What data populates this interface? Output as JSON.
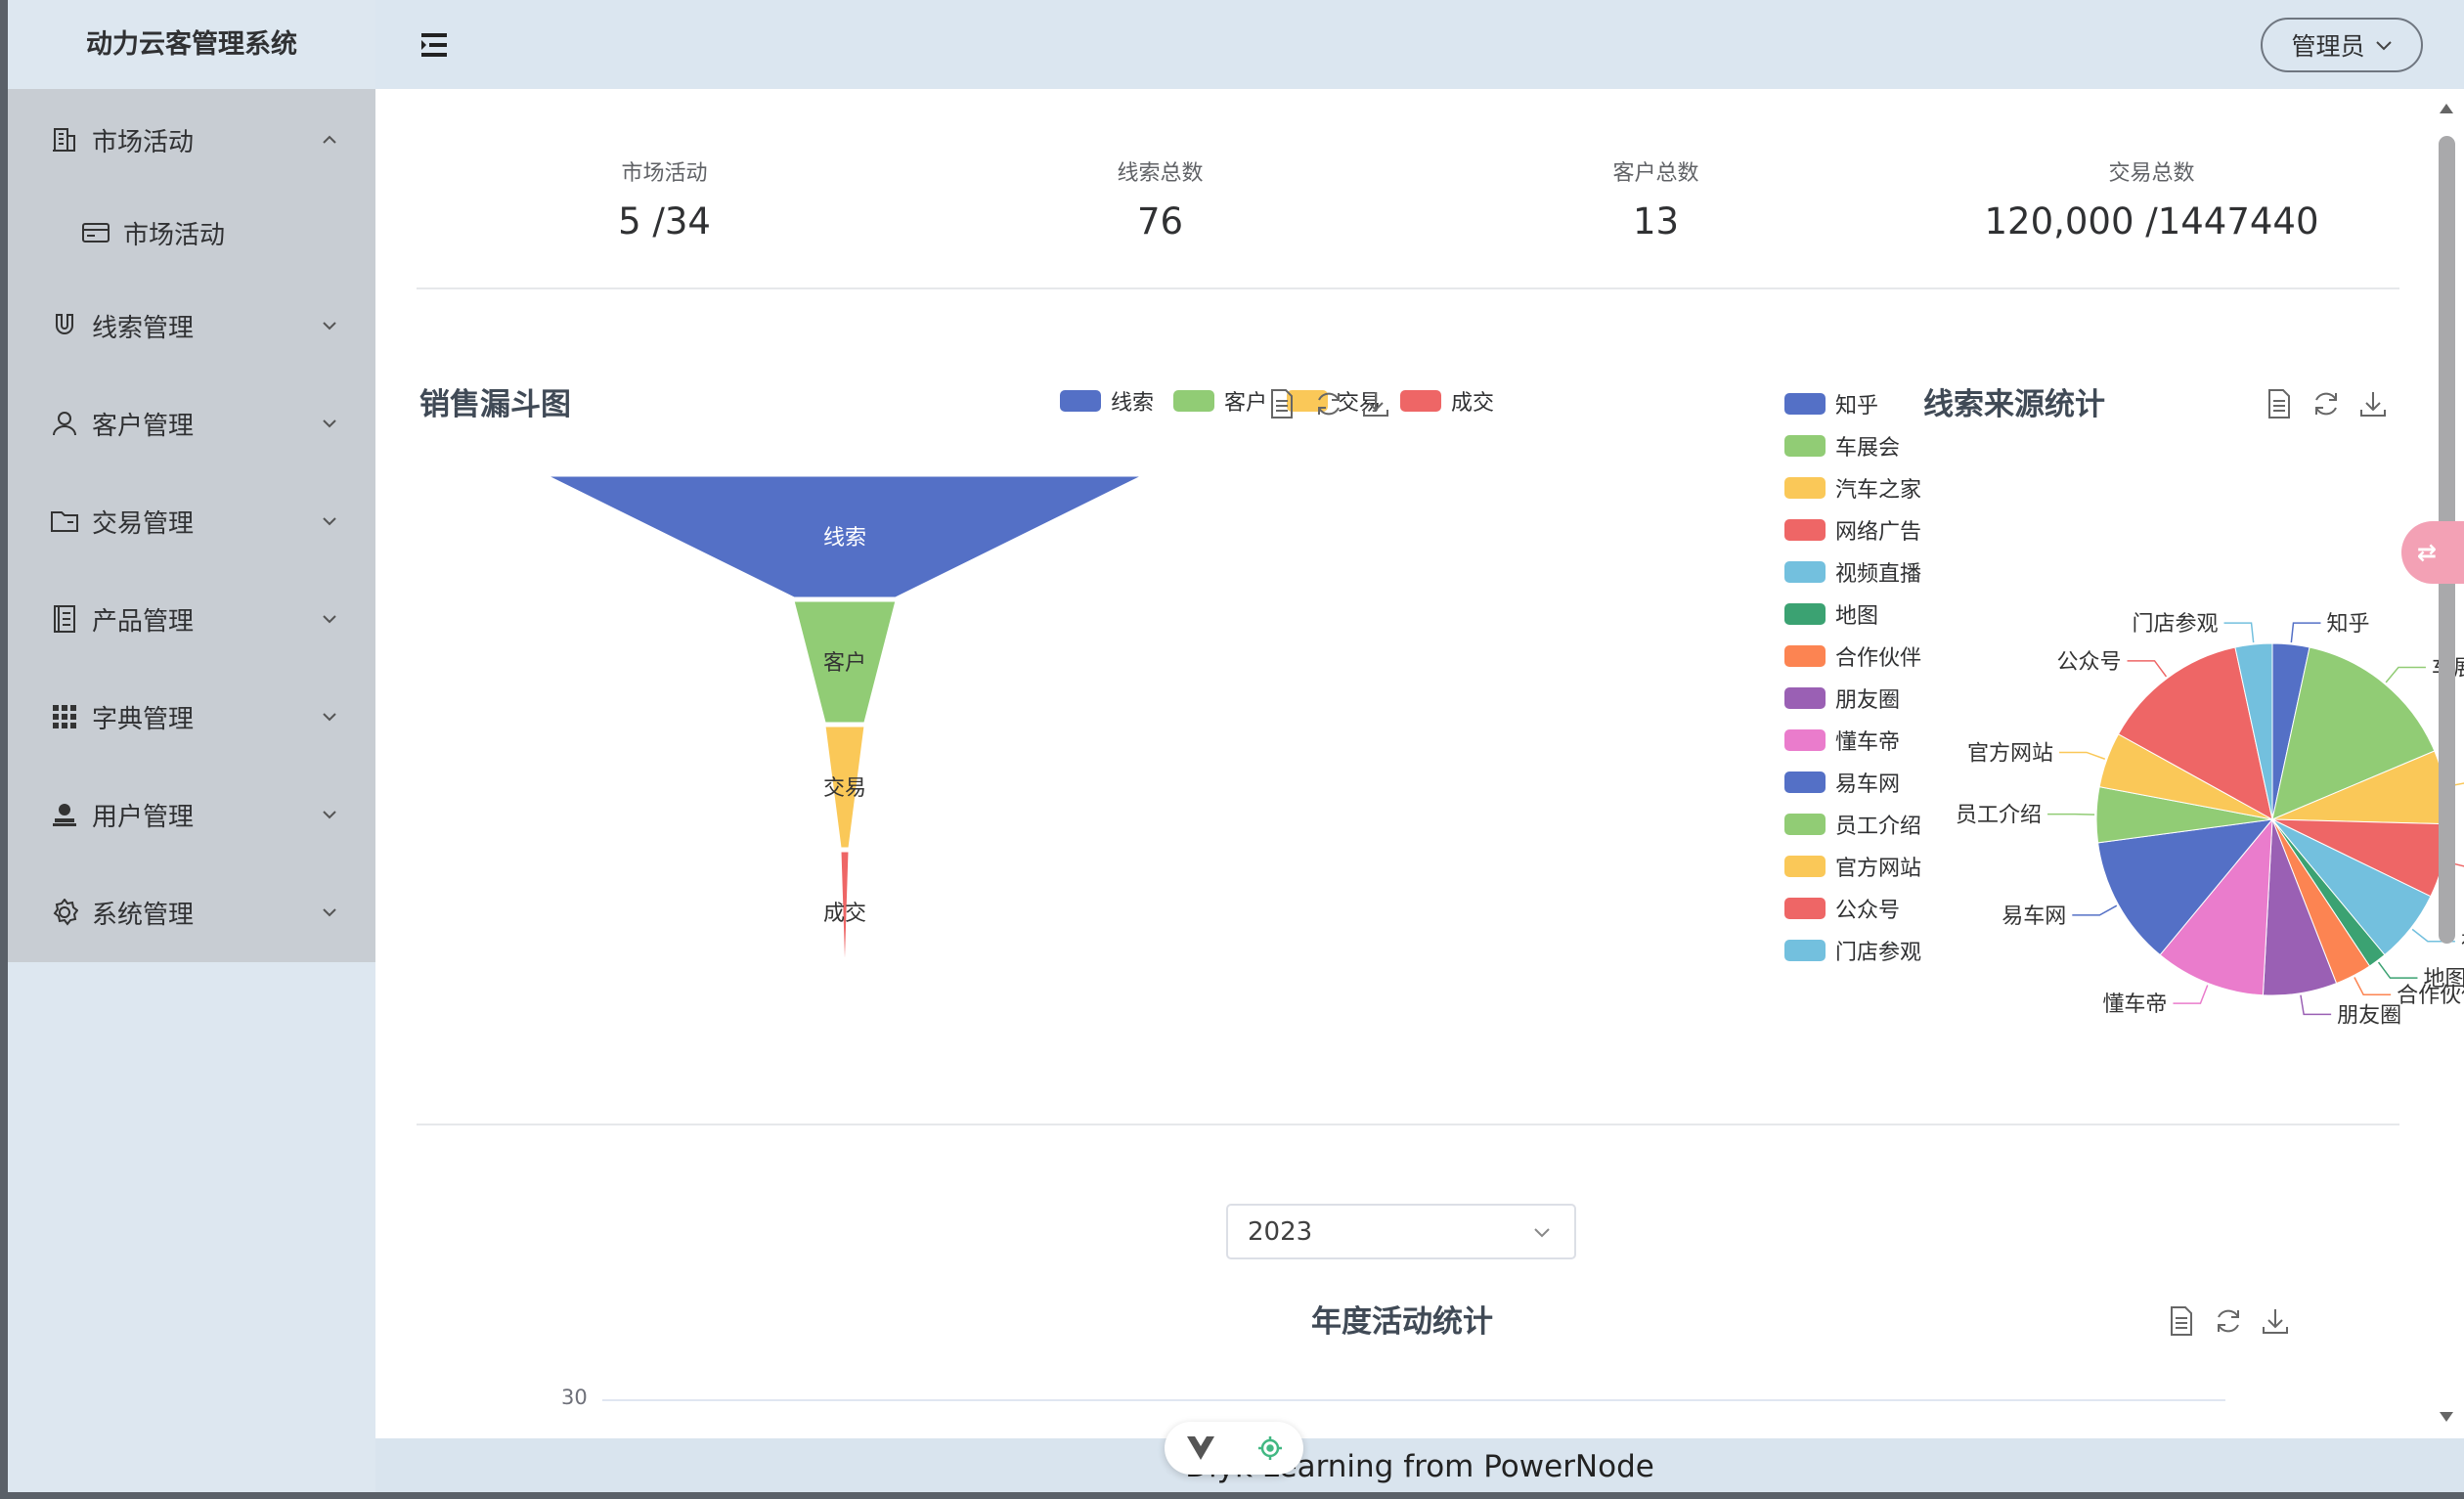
{
  "app": {
    "title": "动力云客管理系统",
    "footer": "Dlyk Learning from PowerNode",
    "user_menu": "管理员"
  },
  "sidebar": {
    "items": [
      {
        "label": "市场活动",
        "icon": "building-icon",
        "expanded": true
      },
      {
        "label": "市场活动",
        "icon": "card-icon",
        "sub": true
      },
      {
        "label": "线索管理",
        "icon": "magnet-icon"
      },
      {
        "label": "客户管理",
        "icon": "user-icon"
      },
      {
        "label": "交易管理",
        "icon": "folder-icon"
      },
      {
        "label": "产品管理",
        "icon": "document-icon"
      },
      {
        "label": "字典管理",
        "icon": "grid-icon"
      },
      {
        "label": "用户管理",
        "icon": "person-icon"
      },
      {
        "label": "系统管理",
        "icon": "gear-icon"
      }
    ]
  },
  "stats": [
    {
      "title": "市场活动",
      "value": "5 /34"
    },
    {
      "title": "线索总数",
      "value": "76"
    },
    {
      "title": "客户总数",
      "value": "13"
    },
    {
      "title": "交易总数",
      "value": "120,000 /1447440"
    }
  ],
  "year_select": {
    "value": "2023"
  },
  "colors": {
    "accent": "#5470c6",
    "sidebar_bg": "#c8cdd3",
    "topbar_bg": "#dbe6f0"
  },
  "chart_data": [
    {
      "type": "funnel",
      "title": "销售漏斗图",
      "categories": [
        "线索",
        "客户",
        "交易",
        "成交"
      ],
      "values": [
        76,
        13,
        5,
        1
      ],
      "colors": [
        "#5470c6",
        "#91cc75",
        "#fac858",
        "#ee6666"
      ],
      "legend": "top"
    },
    {
      "type": "pie",
      "title": "线索来源统计",
      "categories": [
        "知乎",
        "车展会",
        "汽车之家",
        "网络广告",
        "视频直播",
        "地图",
        "合作伙伴",
        "朋友圈",
        "懂车帝",
        "易车网",
        "员工介绍",
        "官方网站",
        "公众号",
        "门店参观"
      ],
      "values": [
        2,
        9,
        4,
        4,
        4,
        1,
        2,
        4,
        6,
        7,
        3,
        3,
        8,
        2
      ],
      "colors": [
        "#5470c6",
        "#91cc75",
        "#fac858",
        "#ee6666",
        "#73c0de",
        "#3ba272",
        "#fc8452",
        "#9a60b4",
        "#ea7ccc",
        "#5470c6",
        "#91cc75",
        "#fac858",
        "#ee6666",
        "#73c0de"
      ],
      "legend": "left"
    },
    {
      "type": "bar",
      "title": "年度活动统计",
      "y_ticks": [
        "30"
      ]
    }
  ]
}
